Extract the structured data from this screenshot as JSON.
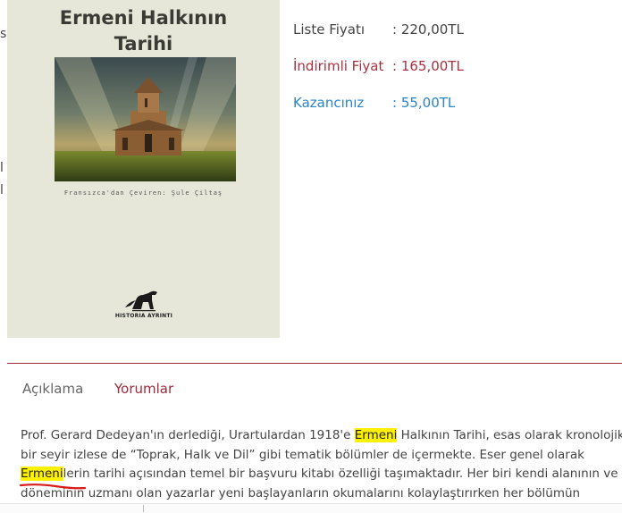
{
  "edge_fragments": [
    "s",
    "l",
    "l"
  ],
  "book": {
    "cover_title": "Ermeni Halkının\nTarihi",
    "cover_credit": "Fransızca'dan Çeviren: Şule Çiltaş",
    "publisher": "HISTORIA AYRINTI"
  },
  "prices": {
    "list_label": "Liste Fiyatı",
    "list_value": ": 220,00TL",
    "discount_label": "İndirimli Fiyat",
    "discount_value": ": 165,00TL",
    "savings_label": "Kazancınız",
    "savings_value": ": 55,00TL",
    "colors": {
      "list": "#444444",
      "discount": "#a7323f",
      "savings": "#2a84c6"
    }
  },
  "tabs": [
    {
      "label": "Açıklama"
    },
    {
      "label": "Yorumlar"
    }
  ],
  "description": {
    "l1_a": "Prof. Gerard Dedeyan'ın derlediği, Urartulardan 1918'e ",
    "l1_hl": "Ermeni",
    "l1_b": " Halkının Tarihi, esas olarak kronolojik",
    "l2": "bir seyir izlese de “Toprak, Halk ve Dil” gibi tematik bölümler de içermekte. Eser genel olarak",
    "l3_hl": "Ermeni",
    "l3_b": "lerin tarihi açısından temel bir başvuru kitabı özelliği taşımaktadır. Her biri kendi alanının ve",
    "l4": "döneminin uzmanı olan yazarlar yeni başlayanların okumalarını kolaylaştırırken her bölümün",
    "highlight_color": "#fff100"
  }
}
